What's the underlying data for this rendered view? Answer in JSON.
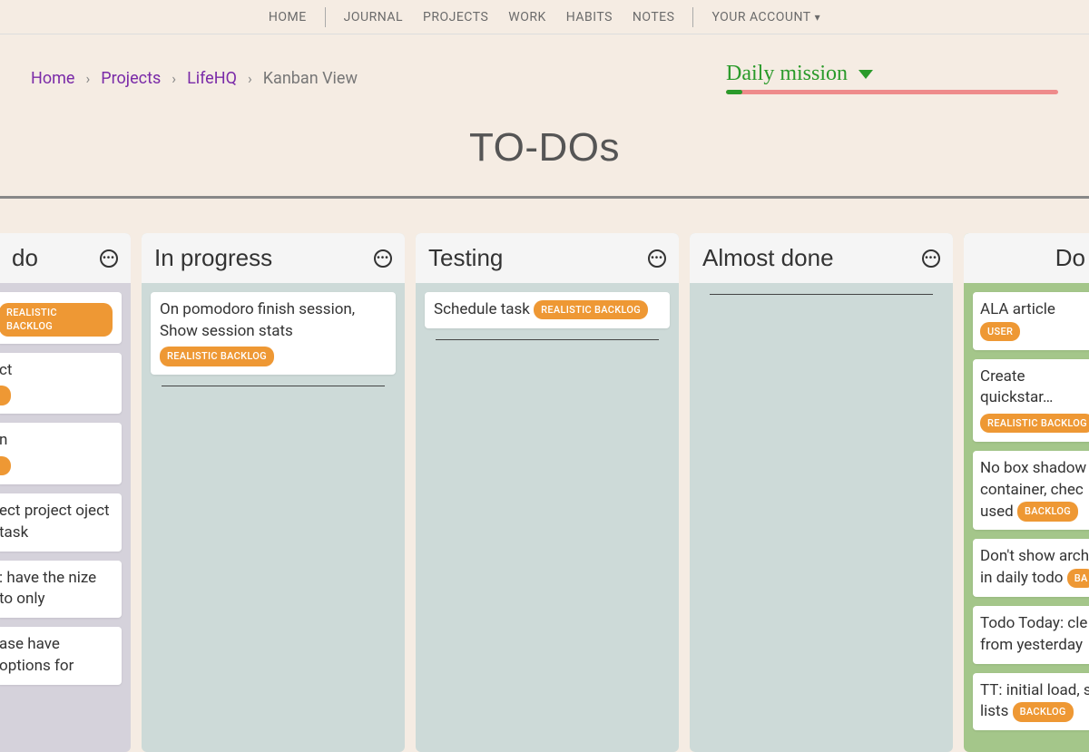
{
  "nav": {
    "home": "HOME",
    "journal": "JOURNAL",
    "projects": "PROJECTS",
    "work": "WORK",
    "habits": "HABITS",
    "notes": "NOTES",
    "account": "YOUR ACCOUNT"
  },
  "breadcrumb": {
    "home": "Home",
    "projects": "Projects",
    "lifehq": "LifeHQ",
    "current": "Kanban View"
  },
  "daily_mission": {
    "label": "Daily mission",
    "progress_percent": 5
  },
  "page_title": "TO-DOs",
  "tags": {
    "realistic_backlog": "REALISTIC BACKLOG",
    "backlog": "BACKLOG",
    "user": "USER",
    "ba": "BA"
  },
  "columns": {
    "todo": {
      "title": "do"
    },
    "inprogress": {
      "title": "In progress"
    },
    "testing": {
      "title": "Testing"
    },
    "almostdone": {
      "title": "Almost done"
    },
    "done": {
      "title": "Do"
    }
  },
  "cards": {
    "todo": [
      {
        "text": "",
        "tag": "realistic_backlog"
      },
      {
        "text": "ct",
        "tag_trunc": true
      },
      {
        "text": "n",
        "tag_trunc": true
      },
      {
        "text": "ect project oject task"
      },
      {
        "text": ": have the nize to only"
      },
      {
        "text": "ase have options for"
      }
    ],
    "inprogress": [
      {
        "text": "On pomodoro finish session, Show session stats",
        "tag": "realistic_backlog"
      }
    ],
    "testing": [
      {
        "text": "Schedule task",
        "tag": "realistic_backlog",
        "inline": true
      }
    ],
    "done": [
      {
        "text": "ALA article",
        "tag": "user",
        "inline": true
      },
      {
        "text": "Create quickstar…",
        "tag": "realistic_backlog"
      },
      {
        "text": "No box shadow container, chec used",
        "tag": "backlog",
        "inline": true
      },
      {
        "text": "Don't show arch in daily todo",
        "tag": "ba",
        "inline": true
      },
      {
        "text": "Todo Today: cle from yesterday"
      },
      {
        "text": "TT: initial load, s lists",
        "tag": "backlog",
        "inline": true
      }
    ]
  }
}
